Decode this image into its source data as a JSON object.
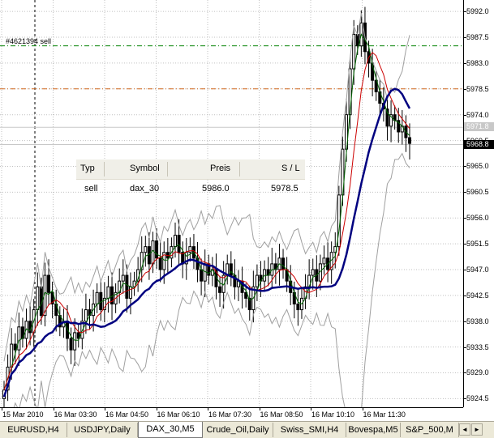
{
  "order_label": "#4621394 sell",
  "price_axis": {
    "ticks": [
      "5992.0",
      "5987.5",
      "5983.0",
      "5978.5",
      "5974.0",
      "5969.5",
      "5965.0",
      "5960.5",
      "5956.0",
      "5951.5",
      "5947.0",
      "5942.5",
      "5938.0",
      "5933.5",
      "5929.0",
      "5924.5"
    ],
    "ask_label": "5971.8",
    "bid_label": "5968.8",
    "ask_price": 5971.8,
    "bid_price": 5968.8
  },
  "time_axis": {
    "labels": [
      "15 Mar 2010",
      "16 Mar 03:30",
      "16 Mar 04:50",
      "16 Mar 06:10",
      "16 Mar 07:30",
      "16 Mar 08:50",
      "16 Mar 10:10",
      "16 Mar 11:30"
    ]
  },
  "trade_table": {
    "headers": {
      "type": "Typ",
      "symbol": "Symbol",
      "price": "Preis",
      "sl": "S / L"
    },
    "row": {
      "type": "sell",
      "symbol": "dax_30",
      "price": "5986.0",
      "sl": "5978.5"
    }
  },
  "levels": {
    "entry": 5986.0,
    "stop_loss": 5978.5
  },
  "colors": {
    "entry_line": "#008000",
    "sl_line": "#d2691e",
    "candle": "#000000",
    "ma_slow": "#000080",
    "ma_mid": "#cc0000",
    "ma_fast": "#006400",
    "bands": "#a0a0a0",
    "grid": "#c0c0c0"
  },
  "tabs": [
    {
      "label": "EURUSD,H4",
      "active": false
    },
    {
      "label": "USDJPY,Daily",
      "active": false
    },
    {
      "label": "DAX_30,M5",
      "active": true
    },
    {
      "label": "Crude_Oil,Daily",
      "active": false
    },
    {
      "label": "Swiss_SMI,H4",
      "active": false
    },
    {
      "label": "Bovespa,M5",
      "active": false
    },
    {
      "label": "S&P_500,M",
      "active": false
    }
  ],
  "chart_data": {
    "type": "candlestick",
    "symbol": "DAX_30",
    "timeframe": "M5",
    "ylim": [
      5923.0,
      5994.0
    ],
    "closes": [
      5926,
      5930,
      5934,
      5933,
      5937,
      5935,
      5938,
      5936,
      5940,
      5944,
      5939,
      5946,
      5943,
      5941,
      5939,
      5937,
      5938,
      5935,
      5933,
      5936,
      5935,
      5938,
      5940,
      5939,
      5941,
      5943,
      5940,
      5942,
      5944,
      5941,
      5943,
      5945,
      5946,
      5942,
      5944,
      5945,
      5947,
      5950,
      5951,
      5948,
      5952,
      5949,
      5947,
      5950,
      5949,
      5951,
      5953,
      5950,
      5948,
      5950,
      5951,
      5949,
      5947,
      5945,
      5948,
      5946,
      5947,
      5944,
      5943,
      5946,
      5948,
      5946,
      5944,
      5945,
      5943,
      5942,
      5940,
      5944,
      5946,
      5945,
      5947,
      5946,
      5948,
      5947,
      5949,
      5947,
      5945,
      5943,
      5941,
      5940,
      5942,
      5944,
      5946,
      5947,
      5945,
      5948,
      5949,
      5947,
      5950,
      5951,
      5960,
      5968,
      5974,
      5982,
      5988,
      5986,
      5990,
      5985,
      5983,
      5980,
      5978,
      5976,
      5975,
      5972,
      5974,
      5973,
      5971,
      5972,
      5970,
      5969
    ]
  }
}
